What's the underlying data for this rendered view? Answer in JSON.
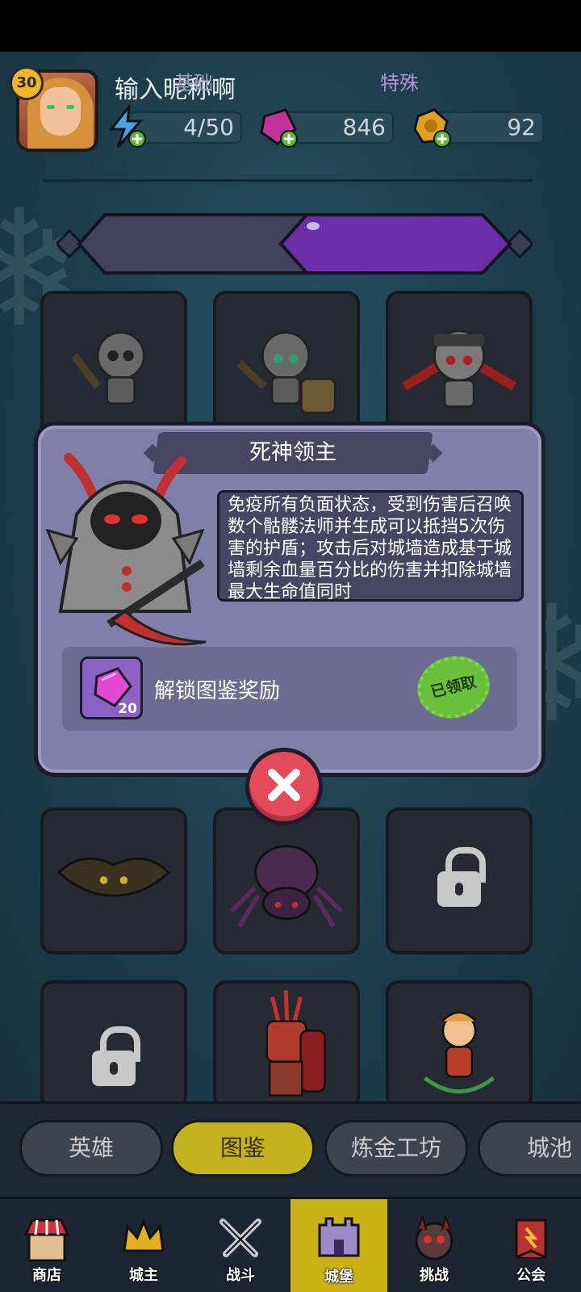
{
  "player": {
    "level": "30",
    "nickname": "输入昵称啊"
  },
  "resources": {
    "energy": "4/50",
    "gems": "846",
    "coins": "92"
  },
  "tabs": {
    "basic": "基础",
    "special": "特殊"
  },
  "modal": {
    "title": "死神领主",
    "description": "免疫所有负面状态，受到伤害后召唤数个骷髅法师并生成可以抵挡5次伤害的护盾；攻击后对城墙造成基于城墙剩余血量百分比的伤害并扣除城墙最大生命值同时",
    "reward_label": "解锁图鉴奖励",
    "reward_count": "20",
    "claimed_stamp": "已领取"
  },
  "categories": [
    "英雄",
    "图鉴",
    "炼金工坊",
    "城池"
  ],
  "nav": [
    "商店",
    "城主",
    "战斗",
    "城堡",
    "挑战",
    "公会"
  ],
  "colors": {
    "accent_yellow": "#c9b116",
    "modal_bg": "#7f7fa7",
    "close_red": "#e34a5a"
  }
}
